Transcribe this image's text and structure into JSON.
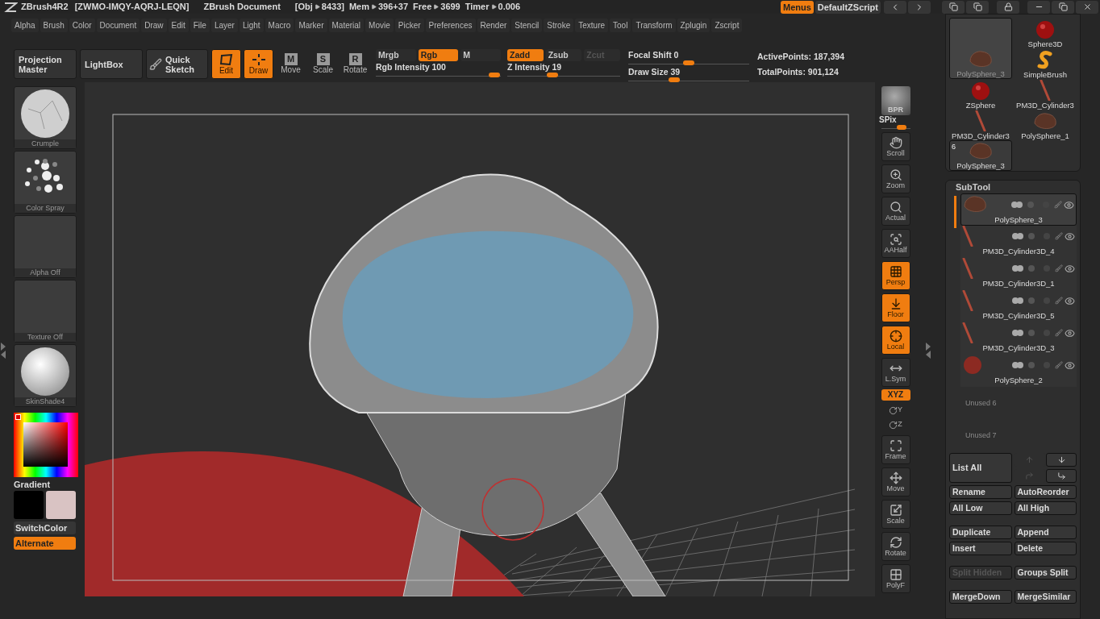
{
  "title_bar": {
    "app": "ZBrush4R2",
    "serial": "[ZWMO-IMQY-AQRJ-LEQN]",
    "document": "ZBrush Document",
    "stats": [
      {
        "label": "[Obj",
        "value": "8433]"
      },
      {
        "label": "Mem",
        "value": "396+37"
      },
      {
        "label": "Free",
        "value": "3699"
      },
      {
        "label": "Timer",
        "value": "0.006"
      }
    ],
    "buttons": [
      {
        "label": "Menus",
        "selected": true
      },
      {
        "label": "DefaultZScript",
        "selected": false
      }
    ]
  },
  "menu": [
    "Alpha",
    "Brush",
    "Color",
    "Document",
    "Draw",
    "Edit",
    "File",
    "Layer",
    "Light",
    "Macro",
    "Marker",
    "Material",
    "Movie",
    "Picker",
    "Preferences",
    "Render",
    "Stencil",
    "Stroke",
    "Texture",
    "Tool",
    "Transform",
    "Zplugin",
    "Zscript"
  ],
  "toolbar": {
    "panels": [
      "Projection Master",
      "LightBox"
    ],
    "quick_sketch": "Quick Sketch",
    "modes": [
      {
        "label": "Edit",
        "kind": "edit",
        "selected": true
      },
      {
        "label": "Draw",
        "kind": "draw",
        "selected": true
      },
      {
        "label": "Move",
        "kind": "letter",
        "key": "M",
        "selected": false
      },
      {
        "label": "Scale",
        "kind": "letter",
        "key": "S",
        "selected": false
      },
      {
        "label": "Rotate",
        "kind": "letter",
        "key": "R",
        "selected": false
      }
    ],
    "toggles": [
      {
        "label": "Mrgb",
        "on": false,
        "disabled": false
      },
      {
        "label": "Rgb",
        "on": true,
        "disabled": false
      },
      {
        "label": "M",
        "on": false,
        "disabled": false
      },
      {
        "label": "Zadd",
        "on": true,
        "disabled": false
      },
      {
        "label": "Zsub",
        "on": false,
        "disabled": false
      },
      {
        "label": "Zcut",
        "on": false,
        "disabled": true
      }
    ],
    "sliders": [
      {
        "label": "Rgb Intensity",
        "value": "100",
        "level": 0.95
      },
      {
        "label": "Z Intensity",
        "value": "19",
        "level": 0.4
      },
      {
        "label": "Focal Shift",
        "value": "0",
        "level": 0.5
      },
      {
        "label": "Draw Size",
        "value": "39",
        "level": 0.38
      }
    ],
    "points": [
      {
        "label": "ActivePoints:",
        "value": "187,394"
      },
      {
        "label": "TotalPoints:",
        "value": "901,124"
      }
    ]
  },
  "left_shelf": {
    "swatches": [
      {
        "label": "Crumple",
        "kind": "crumple"
      },
      {
        "label": "Color Spray",
        "kind": "spray"
      },
      {
        "label": "Alpha Off",
        "kind": "empty"
      },
      {
        "label": "Texture Off",
        "kind": "empty"
      },
      {
        "label": "SkinShade4",
        "kind": "sphere"
      }
    ],
    "gradient": "Gradient",
    "colors": [
      {
        "color": "#000000"
      },
      {
        "color": "#d9c3c3"
      }
    ],
    "buttons": [
      {
        "label": "SwitchColor",
        "selected": false
      },
      {
        "label": "Alternate",
        "selected": true
      }
    ]
  },
  "right_toolbar": {
    "bpr": "BPR",
    "spix": {
      "label": "SPix",
      "level": 0.7
    },
    "tools": [
      {
        "label": "Scroll",
        "kind": "scroll",
        "on": false
      },
      {
        "label": "Zoom",
        "kind": "zoom",
        "on": false
      },
      {
        "label": "Actual",
        "kind": "actual",
        "on": false
      },
      {
        "label": "AAHalf",
        "kind": "aahalf",
        "on": false
      },
      {
        "label": "Persp",
        "kind": "persp",
        "on": true
      },
      {
        "label": "Floor",
        "kind": "floor",
        "on": true
      },
      {
        "label": "Local",
        "kind": "local",
        "on": true
      },
      {
        "label": "L.Sym",
        "kind": "lsym",
        "on": false
      },
      {
        "label": "XYZ",
        "kind": "xyz",
        "on": true
      },
      {
        "label": "Y",
        "kind": "axis",
        "on": false
      },
      {
        "label": "Z",
        "kind": "axis",
        "on": false
      },
      {
        "label": "Frame",
        "kind": "frame",
        "on": false
      },
      {
        "label": "Move",
        "kind": "move",
        "on": false
      },
      {
        "label": "Scale",
        "kind": "scale",
        "on": false
      },
      {
        "label": "Rotate",
        "kind": "rotate",
        "on": false
      },
      {
        "label": "PolyF",
        "kind": "polyf",
        "on": false
      }
    ]
  },
  "tool_palette": {
    "items": [
      {
        "label": "Sphere3D",
        "kind": "sphere",
        "selected": false
      },
      {
        "label": "PolySphere_3",
        "kind": "lump",
        "selected": true
      },
      {
        "label": "SimpleBrush",
        "kind": "brush",
        "selected": false
      },
      {
        "label": "ZSphere",
        "kind": "sphere",
        "selected": false
      },
      {
        "label": "PM3D_Cylinder3",
        "kind": "stick",
        "selected": false
      },
      {
        "label": "PM3D_Cylinder3",
        "kind": "stick",
        "selected": false
      },
      {
        "label": "PolySphere_1",
        "kind": "lump",
        "selected": false
      },
      {
        "label": "PolySphere_3",
        "kind": "lump",
        "badge": "6",
        "selected": false
      }
    ]
  },
  "subtool": {
    "title": "SubTool",
    "items": [
      {
        "label": "PolySphere_3",
        "kind": "lump",
        "selected": true
      },
      {
        "label": "PM3D_Cylinder3D_4",
        "kind": "stick",
        "selected": false
      },
      {
        "label": "PM3D_Cylinder3D_1",
        "kind": "stick",
        "selected": false
      },
      {
        "label": "PM3D_Cylinder3D_5",
        "kind": "stick",
        "selected": false
      },
      {
        "label": "PM3D_Cylinder3D_3",
        "kind": "stick",
        "selected": false
      },
      {
        "label": "PolySphere_2",
        "kind": "red",
        "selected": false
      }
    ],
    "unused": [
      "Unused 6",
      "Unused 7"
    ],
    "list_all": "List All",
    "buttons": [
      {
        "label": "Rename",
        "disabled": false
      },
      {
        "label": "AutoReorder",
        "disabled": false
      },
      {
        "label": "All Low",
        "disabled": false
      },
      {
        "label": "All High",
        "disabled": false
      },
      {
        "label": "Duplicate",
        "disabled": false
      },
      {
        "label": "Append",
        "disabled": false
      },
      {
        "label": "Insert",
        "disabled": false
      },
      {
        "label": "Delete",
        "disabled": false
      },
      {
        "label": "Split Hidden",
        "disabled": true
      },
      {
        "label": "Groups Split",
        "disabled": false
      },
      {
        "label": "MergeDown",
        "disabled": false
      },
      {
        "label": "MergeSimilar",
        "disabled": false
      }
    ]
  }
}
